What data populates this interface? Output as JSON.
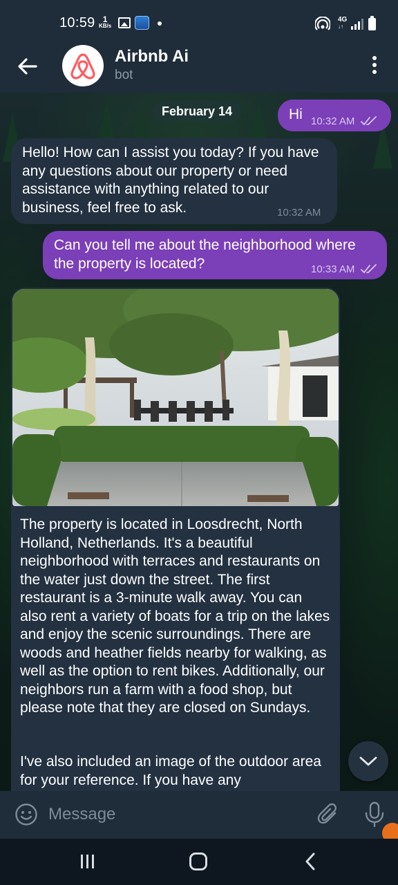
{
  "status_bar": {
    "time": "10:59",
    "net_speed_value": "1",
    "net_speed_unit": "KB/s",
    "network_type": "4G"
  },
  "header": {
    "title": "Airbnb Ai",
    "subtitle": "bot"
  },
  "chat": {
    "date_label": "February 14",
    "messages": [
      {
        "direction": "outgoing",
        "text": "Hi",
        "time": "10:32 AM"
      },
      {
        "direction": "incoming",
        "text": "Hello! How can I assist you today? If you have any questions about our property or need assistance with anything related to our business, feel free to ask.",
        "time": "10:32 AM"
      },
      {
        "direction": "outgoing",
        "text": "Can you tell me about the neighborhood where the property is located?",
        "time": "10:33 AM"
      },
      {
        "direction": "incoming",
        "has_image": true,
        "image_description": "outdoor patio with trees and dining table",
        "paragraph_1": "The property is located in Loosdrecht, North Holland, Netherlands. It's a beautiful neighborhood with terraces and restaurants on the water just down the street. The first restaurant is a 3-minute walk away. You can also rent a variety of boats for a trip on the lakes and enjoy the scenic surroundings. There are woods and heather fields nearby for walking, as well as the option to rent bikes. Additionally, our neighbors run a farm with a food shop, but please note that they are closed on Sundays.",
        "paragraph_2": "I've also included an image of the outdoor area for your reference. If you have any"
      }
    ]
  },
  "input": {
    "placeholder": "Message"
  },
  "colors": {
    "header_bg": "#1f2c3a",
    "outgoing_bubble": "#7b3fb8",
    "incoming_bubble": "#233141",
    "brand_airbnb": "#ff5a5f"
  }
}
